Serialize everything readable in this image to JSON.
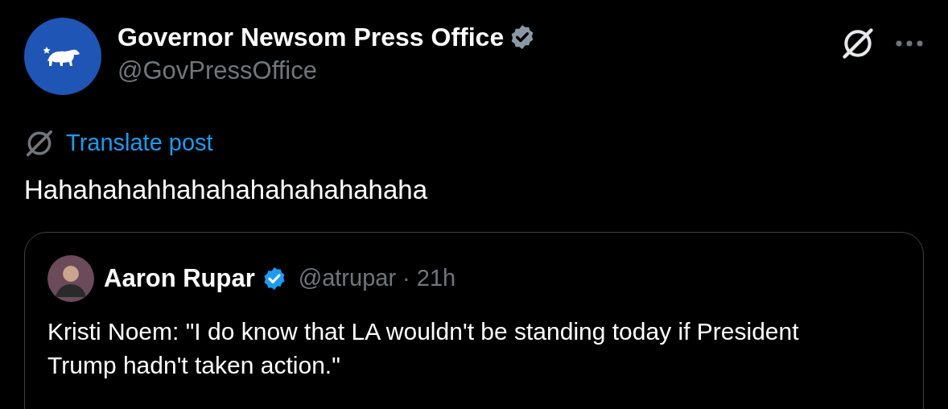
{
  "post": {
    "author": {
      "name": "Governor Newsom Press Office",
      "verified": true,
      "handle": "@GovPressOffice"
    },
    "translate": "Translate post",
    "text": "Hahahahahhahahahahahahahaha",
    "quote": {
      "author": {
        "name": "Aaron Rupar",
        "verified": true,
        "handle": "@atrupar",
        "separator": "·",
        "time": "21h"
      },
      "text": "Kristi Noem: \"I do know that LA wouldn't be standing today if President Trump hadn't taken action.\""
    }
  }
}
